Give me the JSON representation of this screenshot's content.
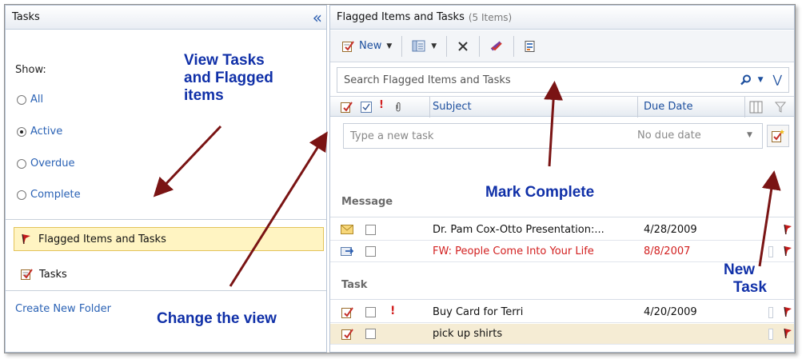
{
  "left_pane": {
    "title": "Tasks",
    "show_label": "Show:",
    "radios": [
      {
        "label": "All",
        "selected": false
      },
      {
        "label": "Active",
        "selected": true
      },
      {
        "label": "Overdue",
        "selected": false
      },
      {
        "label": "Complete",
        "selected": false
      }
    ],
    "folders": [
      {
        "label": "Flagged Items and Tasks",
        "selected": true,
        "icon": "flag-icon"
      },
      {
        "label": "Tasks",
        "selected": false,
        "icon": "task-icon"
      }
    ],
    "create_folder": "Create New Folder"
  },
  "right_pane": {
    "title": "Flagged Items and Tasks",
    "item_count": "(5 Items)",
    "toolbar": {
      "new_label": "New"
    },
    "search_placeholder": "Search Flagged Items and Tasks",
    "columns": {
      "subject": "Subject",
      "due_date": "Due Date"
    },
    "new_task": {
      "placeholder": "Type a new task",
      "due": "No due date"
    },
    "groups": [
      {
        "label": "Message",
        "rows": [
          {
            "subject": "Dr. Pam Cox-Otto Presentation:...",
            "date": "4/28/2009",
            "icon": "envelope-icon",
            "red": false
          },
          {
            "subject": "FW: People Come Into Your Life",
            "date": "8/8/2007",
            "icon": "forwarded-mail-icon",
            "red": true
          }
        ]
      },
      {
        "label": "Task",
        "rows": [
          {
            "subject": "Buy Card for Terri",
            "date": "4/20/2009",
            "icon": "task-icon",
            "red": false,
            "important": true
          },
          {
            "subject": "pick up shirts",
            "date": "",
            "icon": "task-icon",
            "red": false,
            "highlight": true
          }
        ]
      }
    ]
  },
  "annotations": {
    "view_tasks": "View Tasks and Flagged items",
    "view_tasks_lines": [
      "View Tasks",
      "and Flagged",
      "items"
    ],
    "mark_complete": "Mark Complete",
    "new_task_lines": [
      "New",
      "Task"
    ],
    "change_view": "Change the view",
    "color": "#1030a8",
    "arrow_color": "#7a1414"
  },
  "colors": {
    "accent_blue": "#2a62b5",
    "selection_yellow": "#fff4c2",
    "overdue_red": "#d21f1f"
  }
}
